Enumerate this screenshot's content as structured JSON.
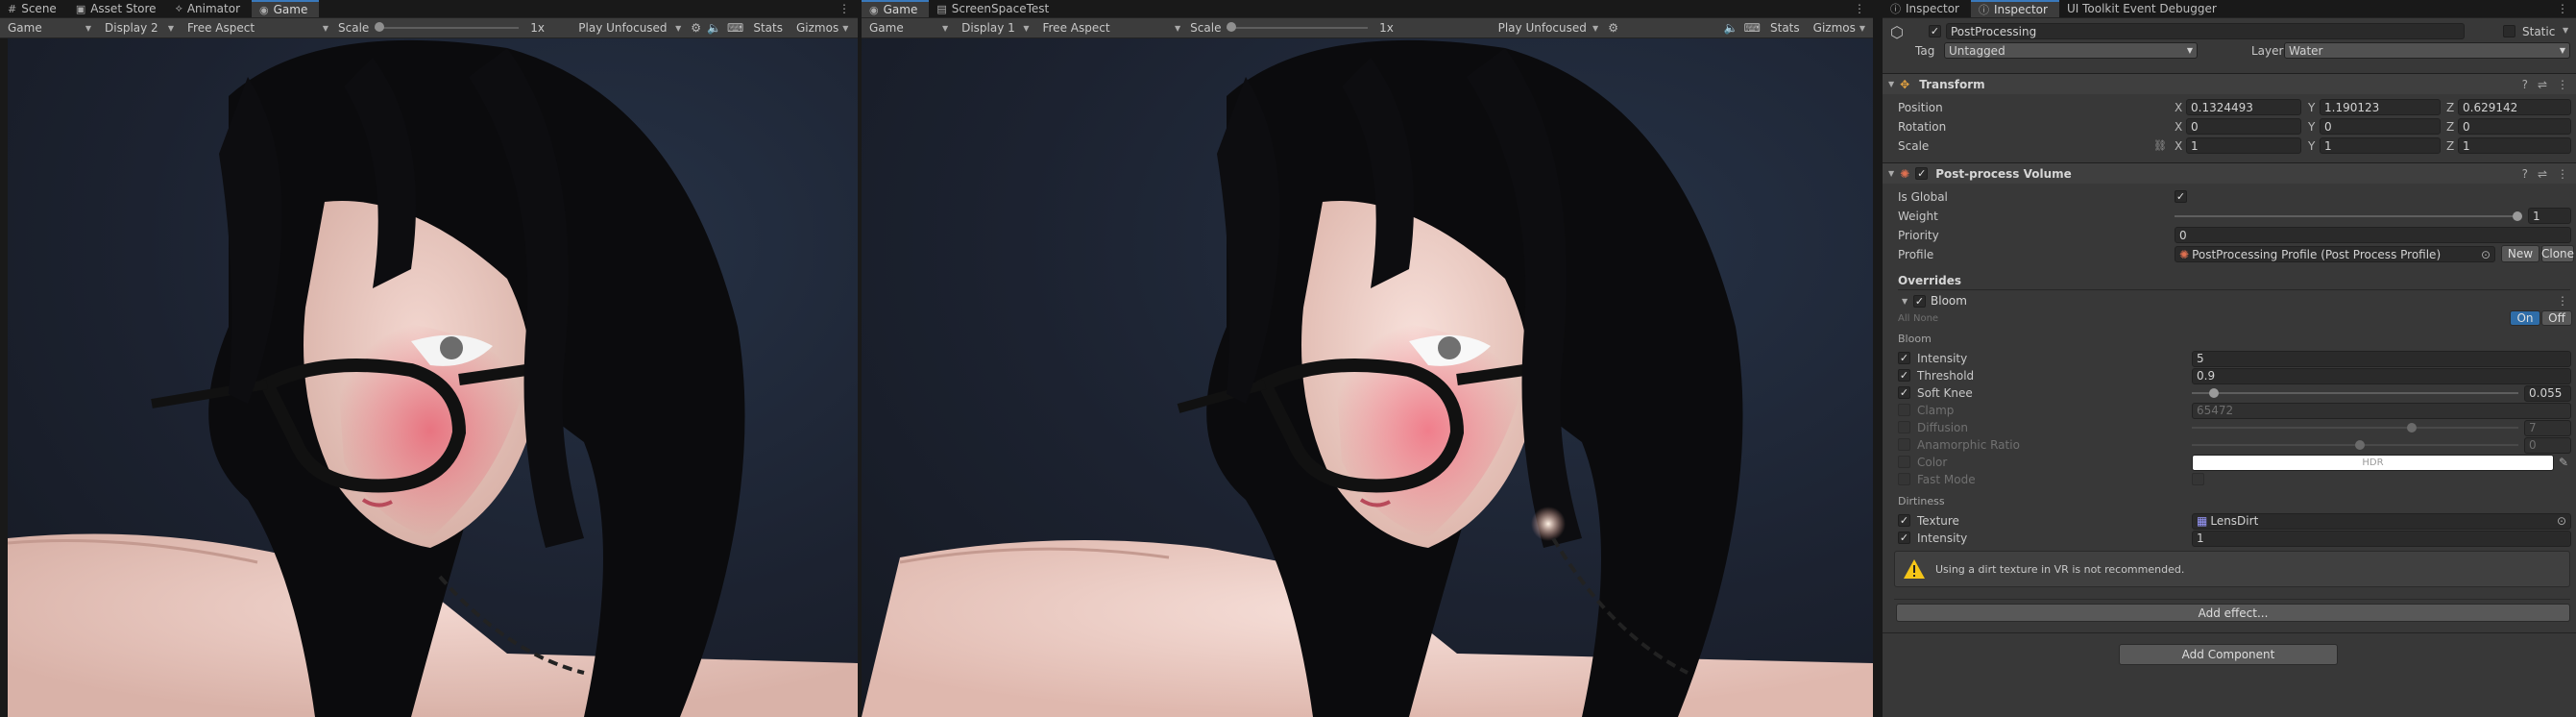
{
  "left_tabs": [
    {
      "label": "Scene",
      "icon": "hash-icon",
      "active": false
    },
    {
      "label": "Asset Store",
      "icon": "store-icon",
      "active": false
    },
    {
      "label": "Animator",
      "icon": "animator-icon",
      "active": false
    },
    {
      "label": "Game",
      "icon": "gamepad-icon",
      "active": true
    }
  ],
  "mid_tabs": [
    {
      "label": "Game",
      "icon": "gamepad-icon",
      "active": true
    },
    {
      "label": "ScreenSpaceTest",
      "icon": "document-icon",
      "active": false
    }
  ],
  "right_tabs": [
    {
      "label": "Inspector",
      "icon": "info-icon",
      "active": false
    },
    {
      "label": "Inspector",
      "icon": "info-icon",
      "active": true
    },
    {
      "label": "UI Toolkit Event Debugger",
      "icon": "",
      "active": false
    }
  ],
  "game_view_1": {
    "mode": "Game",
    "display": "Display 2",
    "aspect": "Free Aspect",
    "scale_label": "Scale",
    "scale_value": "1x",
    "play_mode": "Play Unfocused",
    "stats": "Stats",
    "gizmos": "Gizmos"
  },
  "game_view_2": {
    "mode": "Game",
    "display": "Display 1",
    "aspect": "Free Aspect",
    "scale_label": "Scale",
    "scale_value": "1x",
    "play_mode": "Play Unfocused",
    "stats": "Stats",
    "gizmos": "Gizmos"
  },
  "inspector": {
    "object_name": "PostProcessing",
    "static_label": "Static",
    "tag_label": "Tag",
    "tag_value": "Untagged",
    "layer_label": "Layer",
    "layer_value": "Water",
    "transform": {
      "title": "Transform",
      "position_label": "Position",
      "position": {
        "x": "0.1324493",
        "y": "1.190123",
        "z": "0.629142"
      },
      "rotation_label": "Rotation",
      "rotation": {
        "x": "0",
        "y": "0",
        "z": "0"
      },
      "scale_label": "Scale",
      "scale": {
        "x": "1",
        "y": "1",
        "z": "1"
      }
    },
    "volume": {
      "title": "Post-process Volume",
      "is_global_label": "Is Global",
      "weight_label": "Weight",
      "weight_value": "1",
      "weight_fraction": 1.0,
      "priority_label": "Priority",
      "priority_value": "0",
      "profile_label": "Profile",
      "profile_value": "PostProcessing Profile (Post Process Profile)",
      "new_label": "New",
      "clone_label": "Clone"
    },
    "overrides_label": "Overrides",
    "bloom": {
      "title": "Bloom",
      "all_label": "All",
      "none_label": "None",
      "on_label": "On",
      "off_label": "Off",
      "section_bloom": "Bloom",
      "intensity_label": "Intensity",
      "intensity_value": "5",
      "threshold_label": "Threshold",
      "threshold_value": "0.9",
      "soft_knee_label": "Soft Knee",
      "soft_knee_value": "0.055",
      "soft_knee_fraction": 0.055,
      "clamp_label": "Clamp",
      "clamp_value": "65472",
      "diffusion_label": "Diffusion",
      "diffusion_value": "7",
      "diffusion_fraction": 0.66,
      "anamorphic_label": "Anamorphic Ratio",
      "anamorphic_value": "0",
      "anamorphic_fraction": 0.5,
      "color_label": "Color",
      "color_value": "HDR",
      "color_hex": "#ffffff",
      "fast_mode_label": "Fast Mode",
      "section_dirtiness": "Dirtiness",
      "texture_label": "Texture",
      "texture_value": "LensDirt",
      "dirt_intensity_label": "Intensity",
      "dirt_intensity_value": "1",
      "warning": "Using a dirt texture in VR is not recommended."
    },
    "add_effect_label": "Add effect...",
    "add_component_label": "Add Component"
  },
  "colors": {
    "accent": "#3a79bb",
    "panel": "#383838",
    "toolbar": "#3c3c3c",
    "warning": "#f5c518",
    "on_button": "#2f6da8"
  }
}
